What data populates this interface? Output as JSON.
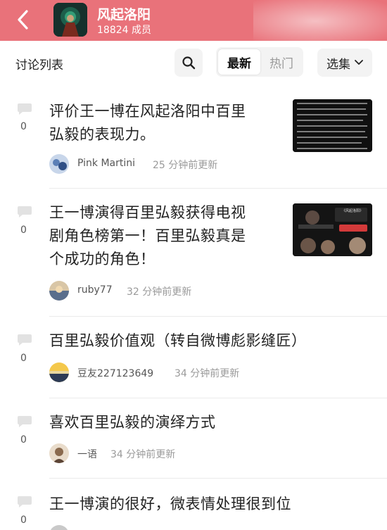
{
  "header": {
    "group_name": "风起洛阳",
    "member_count": "18824 成员",
    "accent_color": "#e9727a"
  },
  "toolbar": {
    "list_title": "讨论列表",
    "tab_new": "最新",
    "tab_hot": "热门",
    "select_label": "选集"
  },
  "threads": [
    {
      "title_lines": [
        "评价王一博在风起洛阳中百里",
        "弘毅的表现力。"
      ],
      "replies": "0",
      "author": "Pink Martini",
      "time": "25 分钟前更新",
      "has_thumbnail": true
    },
    {
      "title_lines": [
        "王一博演得百里弘毅获得电视",
        "剧角色榜第一！百里弘毅真是",
        "个成功的角色！"
      ],
      "replies": "0",
      "author": "ruby77",
      "time": "32 分钟前更新",
      "has_thumbnail": true
    },
    {
      "title_lines": [
        "百里弘毅价值观（转自微博彪影缝匠）"
      ],
      "replies": "0",
      "author": "豆友227123649",
      "time": "34 分钟前更新",
      "has_thumbnail": false
    },
    {
      "title_lines": [
        "喜欢百里弘毅的演绎方式"
      ],
      "replies": "0",
      "author": "一语",
      "time": "34 分钟前更新",
      "has_thumbnail": false
    },
    {
      "title_lines": [
        "王一博演的很好，微表情处理很到位"
      ],
      "replies": "0",
      "author": "",
      "time": "",
      "has_thumbnail": false
    }
  ],
  "icons": {
    "back": "chevron-left-icon",
    "search": "search-icon",
    "dropdown": "chevron-down-icon",
    "reply": "comment-bubble-icon"
  }
}
